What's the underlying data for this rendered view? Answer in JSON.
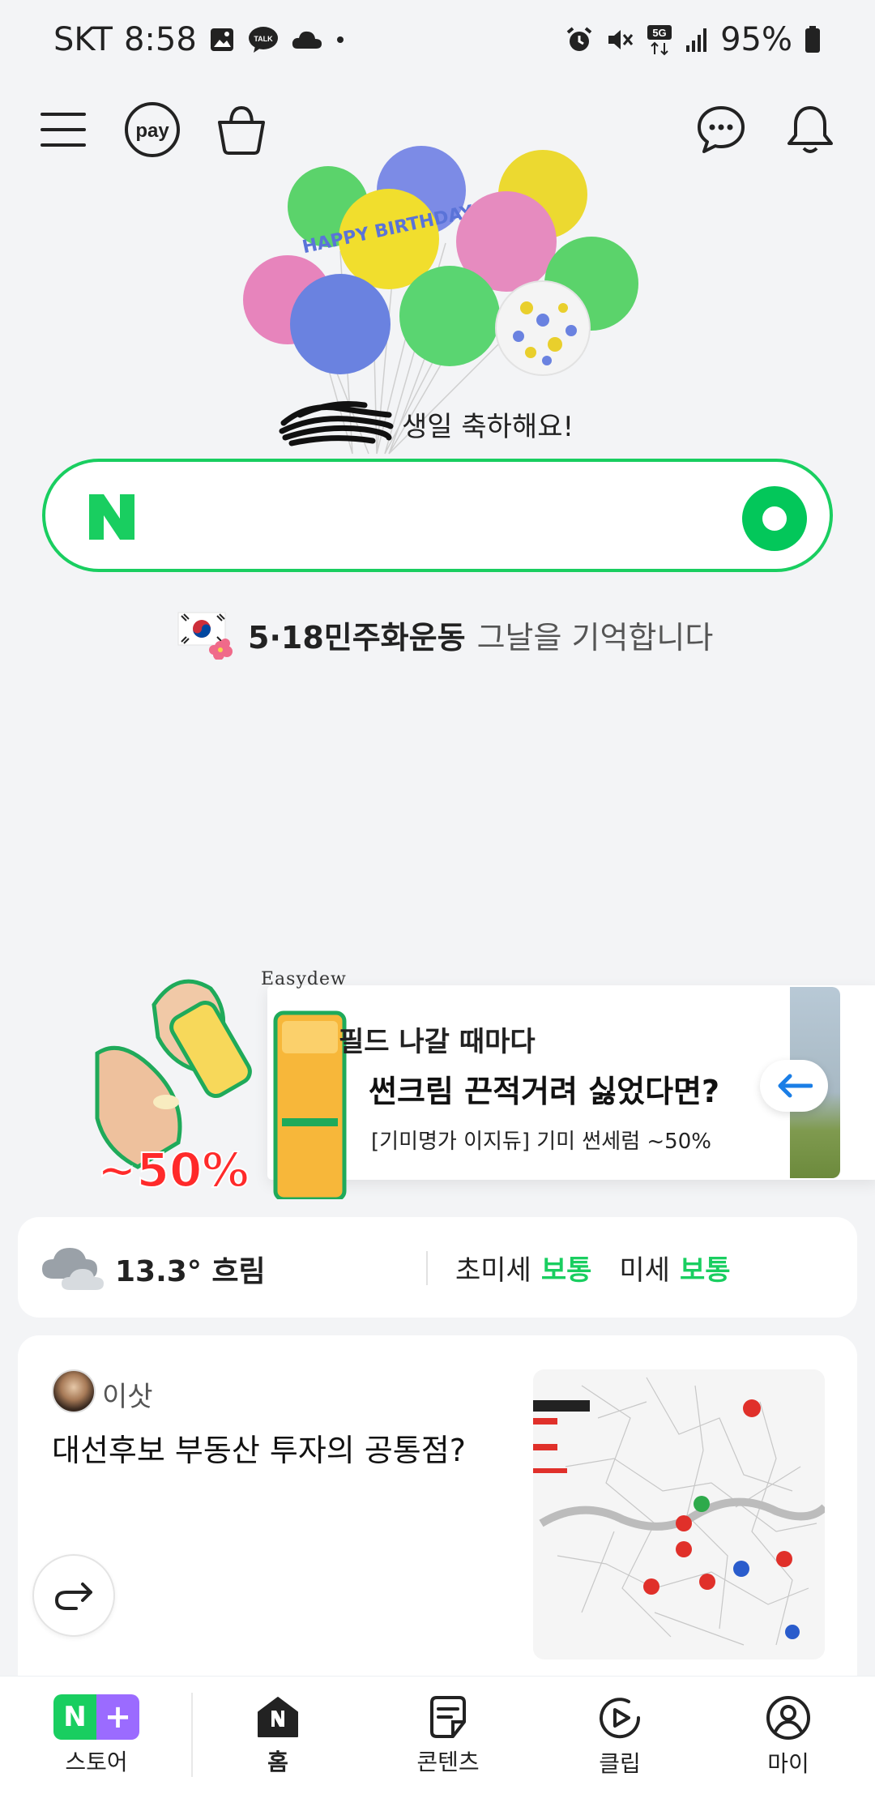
{
  "status_bar": {
    "carrier": "SKT",
    "time": "8:58",
    "talk_badge": "TALK",
    "network": "5G",
    "battery": "95%"
  },
  "topbar": {
    "pay_label": "pay"
  },
  "birthday": {
    "balloon_text": "HAPPY BIRTHDAY",
    "greeting": "생일 축하해요!"
  },
  "search": {
    "logo": "N",
    "value": ""
  },
  "memorial": {
    "title": "5·18민주화운동",
    "subtitle": "그날을 기억합니다"
  },
  "ad": {
    "brand": "Easydew",
    "line1": "필드 나갈 때마다",
    "line2": "썬크림 끈적거려 싫었다면?",
    "line3": "[기미명가 이지듀] 기미 썬세럼 ~50%",
    "discount": "~50%"
  },
  "weather": {
    "temp": "13.3° 흐림",
    "ultrafine_label": "초미세",
    "ultrafine_value": "보통",
    "fine_label": "미세",
    "fine_value": "보통"
  },
  "content_card": {
    "author": "이삿",
    "title": "대선후보 부동산 투자의 공통점?"
  },
  "bottom_nav": {
    "items": [
      {
        "label": "스토어",
        "icon": "n-plus-store-icon"
      },
      {
        "label": "홈",
        "icon": "home-icon"
      },
      {
        "label": "콘텐츠",
        "icon": "contents-icon"
      },
      {
        "label": "클립",
        "icon": "clip-icon"
      },
      {
        "label": "마이",
        "icon": "profile-icon"
      }
    ]
  },
  "colors": {
    "naver_green": "#19ce60",
    "plus_purple": "#9b6bff",
    "background": "#f3f4f6"
  }
}
